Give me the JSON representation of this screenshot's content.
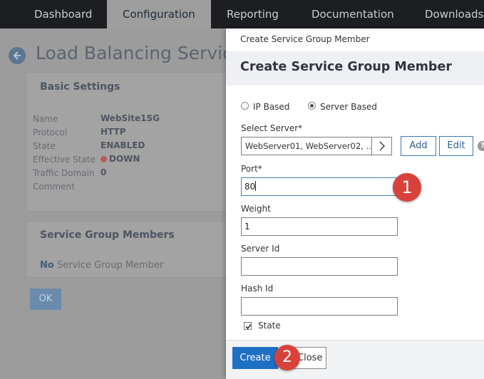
{
  "nav": {
    "tabs": [
      "Dashboard",
      "Configuration",
      "Reporting",
      "Documentation",
      "Downloads"
    ],
    "active_tab": "Configuration"
  },
  "background_page": {
    "title": "Load Balancing Service",
    "basic_settings": {
      "heading": "Basic Settings",
      "rows": [
        {
          "label": "Name",
          "value": "WebSite1SG"
        },
        {
          "label": "Protocol",
          "value": "HTTP"
        },
        {
          "label": "State",
          "value": "ENABLED"
        },
        {
          "label": "Effective State",
          "value": "DOWN"
        },
        {
          "label": "Traffic Domain",
          "value": "0"
        },
        {
          "label": "Comment",
          "value": ""
        }
      ]
    },
    "members": {
      "heading": "Service Group Members",
      "empty_bold": "No",
      "empty_rest": "Service Group Member"
    },
    "ok_label": "OK"
  },
  "dialog": {
    "breadcrumb": "Create Service Group Member",
    "title": "Create Service Group Member",
    "radio_ip": "IP Based",
    "radio_server": "Server Based",
    "select_server_label": "Select Server*",
    "select_server_value": "WebServer01, WebServer02, ...",
    "add_label": "Add",
    "edit_label": "Edit",
    "help_glyph": "?",
    "port_label": "Port*",
    "port_value": "80",
    "weight_label": "Weight",
    "weight_value": "1",
    "server_id_label": "Server Id",
    "server_id_value": "",
    "hash_id_label": "Hash Id",
    "hash_id_value": "",
    "state_label": "State",
    "state_checked": true,
    "create_label": "Create",
    "close_label": "Close"
  },
  "annotations": [
    "1",
    "2"
  ],
  "colors": {
    "nav_bg": "#1c1e21",
    "primary_button": "#1f6fc4",
    "badge": "#d8413a",
    "down_status": "#b85a5a"
  }
}
